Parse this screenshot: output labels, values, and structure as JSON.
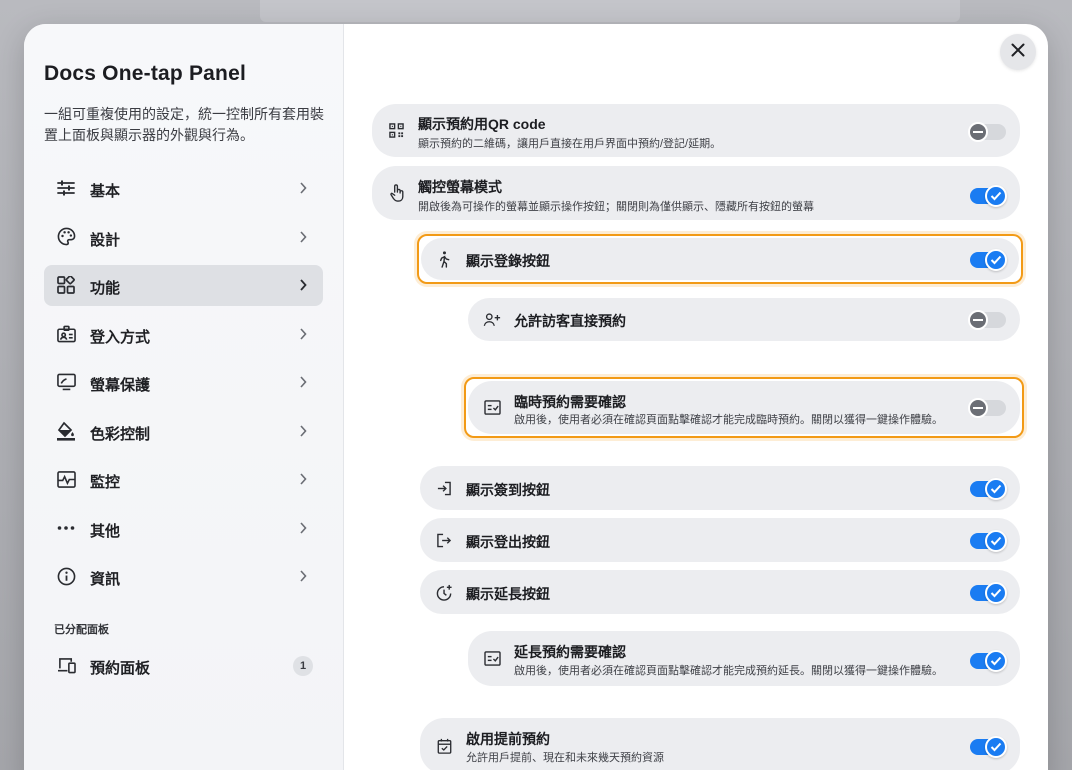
{
  "sidebar": {
    "title": "Docs One-tap Panel",
    "description": "一組可重複使用的設定，統一控制所有套用裝置上面板與顯示器的外觀與行為。",
    "items": [
      {
        "label": "基本",
        "icon": "sliders-icon"
      },
      {
        "label": "設計",
        "icon": "palette-icon"
      },
      {
        "label": "功能",
        "icon": "widgets-icon",
        "active": true
      },
      {
        "label": "登入方式",
        "icon": "id-badge-icon"
      },
      {
        "label": "螢幕保護",
        "icon": "monitor-icon"
      },
      {
        "label": "色彩控制",
        "icon": "paint-bucket-icon"
      },
      {
        "label": "監控",
        "icon": "monitoring-icon"
      },
      {
        "label": "其他",
        "icon": "more-icon"
      },
      {
        "label": "資訊",
        "icon": "info-icon"
      }
    ],
    "section_label": "已分配面板",
    "panels": [
      {
        "label": "預約面板",
        "count": "1",
        "icon": "devices-icon"
      }
    ]
  },
  "settings": [
    {
      "title": "顯示預約用QR code",
      "subtitle": "顯示預約的二維碼，讓用戶直接在用戶界面中預約/登記/延期。",
      "enabled": false,
      "icon": "qr-code-icon"
    },
    {
      "title": "觸控螢幕模式",
      "subtitle": "開啟後為可操作的螢幕並顯示操作按鈕；關閉則為僅供顯示、隱藏所有按鈕的螢幕",
      "enabled": true,
      "icon": "touch-icon"
    },
    {
      "title": "顯示登錄按鈕",
      "subtitle": "",
      "enabled": true,
      "icon": "walk-icon"
    },
    {
      "title": "允許訪客直接預約",
      "subtitle": "",
      "enabled": false,
      "icon": "person-add-icon"
    },
    {
      "title": "臨時預約需要確認",
      "subtitle": "啟用後，使用者必須在確認頁面點擊確認才能完成臨時預約。關閉以獲得一鍵操作體驗。",
      "enabled": false,
      "icon": "checklist-icon"
    },
    {
      "title": "顯示簽到按鈕",
      "subtitle": "",
      "enabled": true,
      "icon": "login-icon"
    },
    {
      "title": "顯示登出按鈕",
      "subtitle": "",
      "enabled": true,
      "icon": "logout-icon"
    },
    {
      "title": "顯示延長按鈕",
      "subtitle": "",
      "enabled": true,
      "icon": "clock-plus-icon"
    },
    {
      "title": "延長預約需要確認",
      "subtitle": "啟用後，使用者必須在確認頁面點擊確認才能完成預約延長。關閉以獲得一鍵操作體驗。",
      "enabled": true,
      "icon": "checklist-icon"
    },
    {
      "title": "啟用提前預約",
      "subtitle": "允許用戶提前、現在和未來幾天預約資源",
      "enabled": true,
      "icon": "calendar-check-icon"
    }
  ],
  "colors": {
    "accent": "#1a7cf2",
    "highlight": "#f29a16",
    "row_bg": "#ecedf0"
  }
}
